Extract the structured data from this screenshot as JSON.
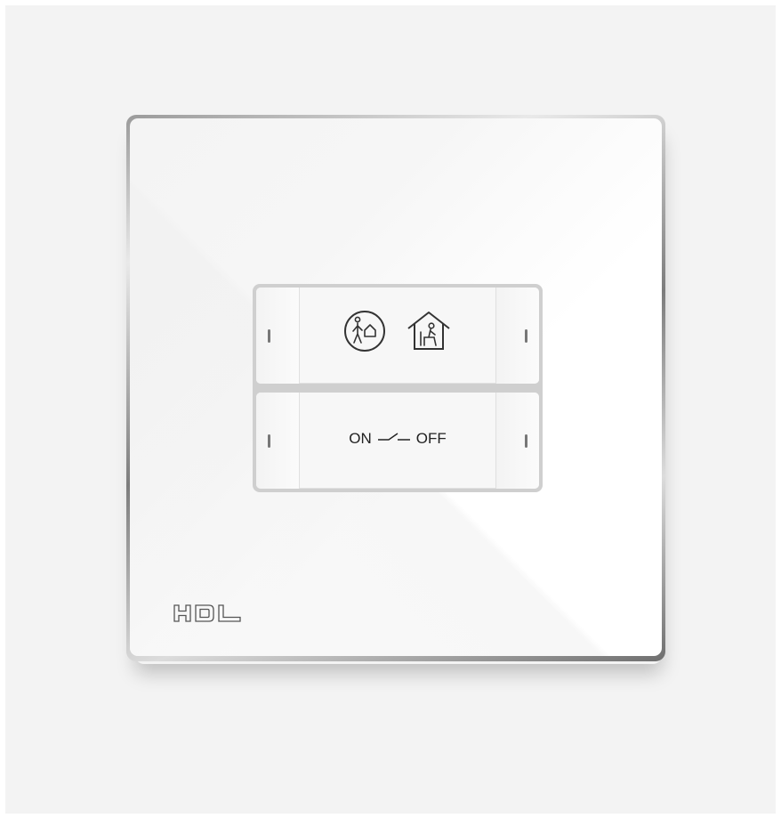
{
  "brand": {
    "logo_text": "HDL"
  },
  "keypad": {
    "top_key": {
      "icons": [
        "person-leaving-home-icon",
        "person-at-home-icon"
      ]
    },
    "bottom_key": {
      "on_label": "ON",
      "off_label": "OFF",
      "switch_symbol": "switch-icon"
    }
  },
  "colors": {
    "panel": "#ffffff",
    "backdrop": "#f3f3f3",
    "keypad_border": "#cfcfcf",
    "key_face": "#f7f7f7",
    "led": "#777777",
    "icon_stroke": "#333333"
  }
}
